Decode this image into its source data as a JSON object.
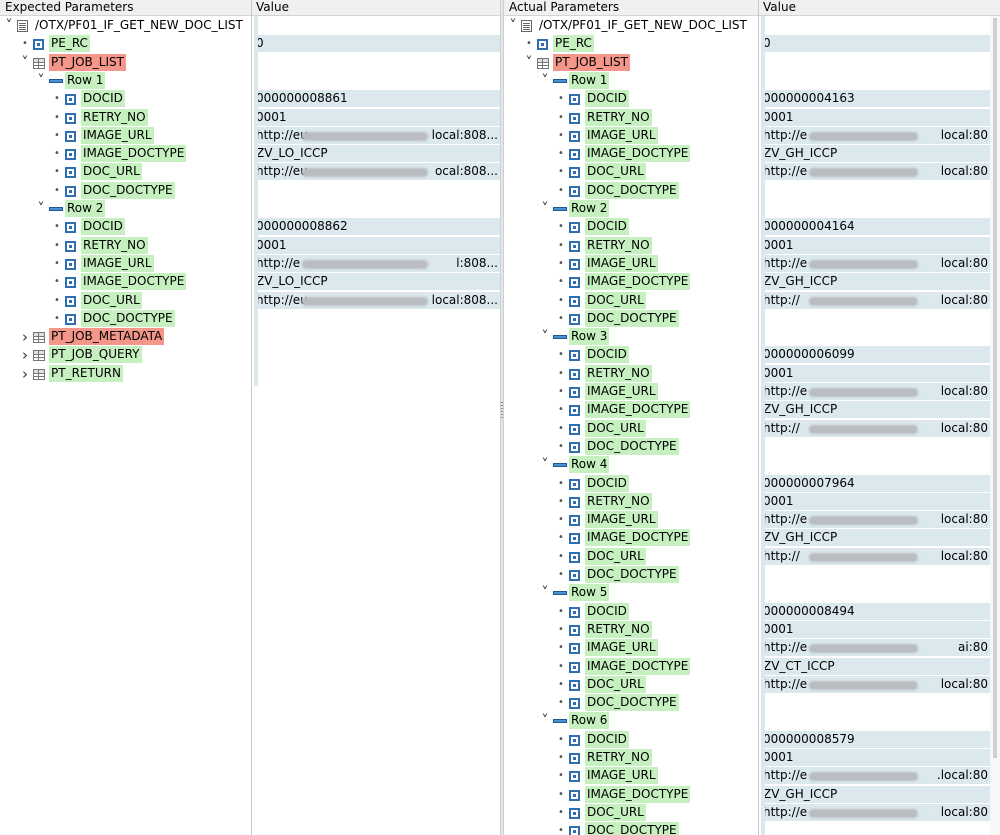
{
  "left_pane": {
    "header": {
      "col1": "Expected Parameters",
      "col2": "Value"
    },
    "rows": [
      {
        "depth": 0,
        "expander": "open",
        "icon": "doc-icon",
        "label": "/OTX/PF01_IF_GET_NEW_DOC_LIST",
        "highlight": "plain",
        "value": ""
      },
      {
        "depth": 1,
        "expander": "dot",
        "icon": "field-icon",
        "label": "PE_RC",
        "highlight": "green",
        "value": "0"
      },
      {
        "depth": 1,
        "expander": "open",
        "icon": "table-icon",
        "label": "PT_JOB_LIST",
        "highlight": "red",
        "value": ""
      },
      {
        "depth": 2,
        "expander": "open",
        "icon": "row-icon",
        "label": "Row 1",
        "highlight": "green",
        "value": ""
      },
      {
        "depth": 3,
        "expander": "dot",
        "icon": "field-icon",
        "label": "DOCID",
        "highlight": "green",
        "value": "000000008861"
      },
      {
        "depth": 3,
        "expander": "dot",
        "icon": "field-icon",
        "label": "RETRY_NO",
        "highlight": "green",
        "value": "0001"
      },
      {
        "depth": 3,
        "expander": "dot",
        "icon": "field-icon",
        "label": "IMAGE_URL",
        "highlight": "green",
        "value": "http://eu",
        "value_tail": "local:808...",
        "blur": true
      },
      {
        "depth": 3,
        "expander": "dot",
        "icon": "field-icon",
        "label": "IMAGE_DOCTYPE",
        "highlight": "green",
        "value": "ZV_LO_ICCP"
      },
      {
        "depth": 3,
        "expander": "dot",
        "icon": "field-icon",
        "label": "DOC_URL",
        "highlight": "green",
        "value": "http://eu",
        "value_tail": "ocal:808...",
        "blur": true
      },
      {
        "depth": 3,
        "expander": "dot",
        "icon": "field-icon",
        "label": "DOC_DOCTYPE",
        "highlight": "green",
        "value": ""
      },
      {
        "depth": 2,
        "expander": "open",
        "icon": "row-icon",
        "label": "Row 2",
        "highlight": "green",
        "value": ""
      },
      {
        "depth": 3,
        "expander": "dot",
        "icon": "field-icon",
        "label": "DOCID",
        "highlight": "green",
        "value": "000000008862"
      },
      {
        "depth": 3,
        "expander": "dot",
        "icon": "field-icon",
        "label": "RETRY_NO",
        "highlight": "green",
        "value": "0001"
      },
      {
        "depth": 3,
        "expander": "dot",
        "icon": "field-icon",
        "label": "IMAGE_URL",
        "highlight": "green",
        "value": "http://e",
        "value_tail": "l:808...",
        "blur": true
      },
      {
        "depth": 3,
        "expander": "dot",
        "icon": "field-icon",
        "label": "IMAGE_DOCTYPE",
        "highlight": "green",
        "value": "ZV_LO_ICCP"
      },
      {
        "depth": 3,
        "expander": "dot",
        "icon": "field-icon",
        "label": "DOC_URL",
        "highlight": "green",
        "value": "http://eu",
        "value_tail": "local:808...",
        "blur": true
      },
      {
        "depth": 3,
        "expander": "dot",
        "icon": "field-icon",
        "label": "DOC_DOCTYPE",
        "highlight": "green",
        "value": ""
      },
      {
        "depth": 1,
        "expander": "closed",
        "icon": "table-icon",
        "label": "PT_JOB_METADATA",
        "highlight": "red",
        "value": ""
      },
      {
        "depth": 1,
        "expander": "closed",
        "icon": "table-icon",
        "label": "PT_JOB_QUERY",
        "highlight": "green",
        "value": ""
      },
      {
        "depth": 1,
        "expander": "closed",
        "icon": "table-icon",
        "label": "PT_RETURN",
        "highlight": "green",
        "value": ""
      }
    ]
  },
  "right_pane": {
    "header": {
      "col1": "Actual Parameters",
      "col2": "Value"
    },
    "rows": [
      {
        "depth": 0,
        "expander": "open",
        "icon": "doc-icon",
        "label": "/OTX/PF01_IF_GET_NEW_DOC_LIST",
        "highlight": "plain",
        "value": ""
      },
      {
        "depth": 1,
        "expander": "dot",
        "icon": "field-icon",
        "label": "PE_RC",
        "highlight": "green",
        "value": "0"
      },
      {
        "depth": 1,
        "expander": "open",
        "icon": "table-icon",
        "label": "PT_JOB_LIST",
        "highlight": "red",
        "value": ""
      },
      {
        "depth": 2,
        "expander": "open",
        "icon": "row-icon",
        "label": "Row 1",
        "highlight": "green",
        "value": ""
      },
      {
        "depth": 3,
        "expander": "dot",
        "icon": "field-icon",
        "label": "DOCID",
        "highlight": "green",
        "value": "000000004163"
      },
      {
        "depth": 3,
        "expander": "dot",
        "icon": "field-icon",
        "label": "RETRY_NO",
        "highlight": "green",
        "value": "0001"
      },
      {
        "depth": 3,
        "expander": "dot",
        "icon": "field-icon",
        "label": "IMAGE_URL",
        "highlight": "green",
        "value": "http://e",
        "value_tail": "local:80",
        "blur": true
      },
      {
        "depth": 3,
        "expander": "dot",
        "icon": "field-icon",
        "label": "IMAGE_DOCTYPE",
        "highlight": "green",
        "value": "ZV_GH_ICCP"
      },
      {
        "depth": 3,
        "expander": "dot",
        "icon": "field-icon",
        "label": "DOC_URL",
        "highlight": "green",
        "value": "http://e",
        "value_tail": "local:80",
        "blur": true
      },
      {
        "depth": 3,
        "expander": "dot",
        "icon": "field-icon",
        "label": "DOC_DOCTYPE",
        "highlight": "green",
        "value": ""
      },
      {
        "depth": 2,
        "expander": "open",
        "icon": "row-icon",
        "label": "Row 2",
        "highlight": "green",
        "value": ""
      },
      {
        "depth": 3,
        "expander": "dot",
        "icon": "field-icon",
        "label": "DOCID",
        "highlight": "green",
        "value": "000000004164"
      },
      {
        "depth": 3,
        "expander": "dot",
        "icon": "field-icon",
        "label": "RETRY_NO",
        "highlight": "green",
        "value": "0001"
      },
      {
        "depth": 3,
        "expander": "dot",
        "icon": "field-icon",
        "label": "IMAGE_URL",
        "highlight": "green",
        "value": "http://e",
        "value_tail": "local:80",
        "blur": true
      },
      {
        "depth": 3,
        "expander": "dot",
        "icon": "field-icon",
        "label": "IMAGE_DOCTYPE",
        "highlight": "green",
        "value": "ZV_GH_ICCP"
      },
      {
        "depth": 3,
        "expander": "dot",
        "icon": "field-icon",
        "label": "DOC_URL",
        "highlight": "green",
        "value": "http://",
        "value_tail": "local:80",
        "blur": true
      },
      {
        "depth": 3,
        "expander": "dot",
        "icon": "field-icon",
        "label": "DOC_DOCTYPE",
        "highlight": "green",
        "value": ""
      },
      {
        "depth": 2,
        "expander": "open",
        "icon": "row-icon",
        "label": "Row 3",
        "highlight": "green",
        "value": ""
      },
      {
        "depth": 3,
        "expander": "dot",
        "icon": "field-icon",
        "label": "DOCID",
        "highlight": "green",
        "value": "000000006099"
      },
      {
        "depth": 3,
        "expander": "dot",
        "icon": "field-icon",
        "label": "RETRY_NO",
        "highlight": "green",
        "value": "0001"
      },
      {
        "depth": 3,
        "expander": "dot",
        "icon": "field-icon",
        "label": "IMAGE_URL",
        "highlight": "green",
        "value": "http://e",
        "value_tail": "local:80",
        "blur": true
      },
      {
        "depth": 3,
        "expander": "dot",
        "icon": "field-icon",
        "label": "IMAGE_DOCTYPE",
        "highlight": "green",
        "value": "ZV_GH_ICCP"
      },
      {
        "depth": 3,
        "expander": "dot",
        "icon": "field-icon",
        "label": "DOC_URL",
        "highlight": "green",
        "value": "http://",
        "value_tail": "local:80",
        "blur": true
      },
      {
        "depth": 3,
        "expander": "dot",
        "icon": "field-icon",
        "label": "DOC_DOCTYPE",
        "highlight": "green",
        "value": ""
      },
      {
        "depth": 2,
        "expander": "open",
        "icon": "row-icon",
        "label": "Row 4",
        "highlight": "green",
        "value": ""
      },
      {
        "depth": 3,
        "expander": "dot",
        "icon": "field-icon",
        "label": "DOCID",
        "highlight": "green",
        "value": "000000007964"
      },
      {
        "depth": 3,
        "expander": "dot",
        "icon": "field-icon",
        "label": "RETRY_NO",
        "highlight": "green",
        "value": "0001"
      },
      {
        "depth": 3,
        "expander": "dot",
        "icon": "field-icon",
        "label": "IMAGE_URL",
        "highlight": "green",
        "value": "http://e",
        "value_tail": "local:80",
        "blur": true
      },
      {
        "depth": 3,
        "expander": "dot",
        "icon": "field-icon",
        "label": "IMAGE_DOCTYPE",
        "highlight": "green",
        "value": "ZV_GH_ICCP"
      },
      {
        "depth": 3,
        "expander": "dot",
        "icon": "field-icon",
        "label": "DOC_URL",
        "highlight": "green",
        "value": "http://",
        "value_tail": "local:80",
        "blur": true
      },
      {
        "depth": 3,
        "expander": "dot",
        "icon": "field-icon",
        "label": "DOC_DOCTYPE",
        "highlight": "green",
        "value": ""
      },
      {
        "depth": 2,
        "expander": "open",
        "icon": "row-icon",
        "label": "Row 5",
        "highlight": "green",
        "value": ""
      },
      {
        "depth": 3,
        "expander": "dot",
        "icon": "field-icon",
        "label": "DOCID",
        "highlight": "green",
        "value": "000000008494"
      },
      {
        "depth": 3,
        "expander": "dot",
        "icon": "field-icon",
        "label": "RETRY_NO",
        "highlight": "green",
        "value": "0001"
      },
      {
        "depth": 3,
        "expander": "dot",
        "icon": "field-icon",
        "label": "IMAGE_URL",
        "highlight": "green",
        "value": "http://e",
        "value_tail": "ai:80",
        "blur": true
      },
      {
        "depth": 3,
        "expander": "dot",
        "icon": "field-icon",
        "label": "IMAGE_DOCTYPE",
        "highlight": "green",
        "value": "ZV_CT_ICCP"
      },
      {
        "depth": 3,
        "expander": "dot",
        "icon": "field-icon",
        "label": "DOC_URL",
        "highlight": "green",
        "value": "http://e",
        "value_tail": "local:80",
        "blur": true
      },
      {
        "depth": 3,
        "expander": "dot",
        "icon": "field-icon",
        "label": "DOC_DOCTYPE",
        "highlight": "green",
        "value": ""
      },
      {
        "depth": 2,
        "expander": "open",
        "icon": "row-icon",
        "label": "Row 6",
        "highlight": "green",
        "value": ""
      },
      {
        "depth": 3,
        "expander": "dot",
        "icon": "field-icon",
        "label": "DOCID",
        "highlight": "green",
        "value": "000000008579"
      },
      {
        "depth": 3,
        "expander": "dot",
        "icon": "field-icon",
        "label": "RETRY_NO",
        "highlight": "green",
        "value": "0001"
      },
      {
        "depth": 3,
        "expander": "dot",
        "icon": "field-icon",
        "label": "IMAGE_URL",
        "highlight": "green",
        "value": "http://e",
        "value_tail": ".local:80",
        "blur": true
      },
      {
        "depth": 3,
        "expander": "dot",
        "icon": "field-icon",
        "label": "IMAGE_DOCTYPE",
        "highlight": "green",
        "value": "ZV_GH_ICCP"
      },
      {
        "depth": 3,
        "expander": "dot",
        "icon": "field-icon",
        "label": "DOC_URL",
        "highlight": "green",
        "value": "http://e",
        "value_tail": "local:80",
        "blur": true
      },
      {
        "depth": 3,
        "expander": "dot",
        "icon": "field-icon",
        "label": "DOC_DOCTYPE",
        "highlight": "green",
        "value": ""
      }
    ]
  },
  "colors": {
    "match": "#c6f0c0",
    "mismatch": "#f4978a",
    "value_bg": "#dbe9ef",
    "field_icon": "#2f6fb0"
  }
}
